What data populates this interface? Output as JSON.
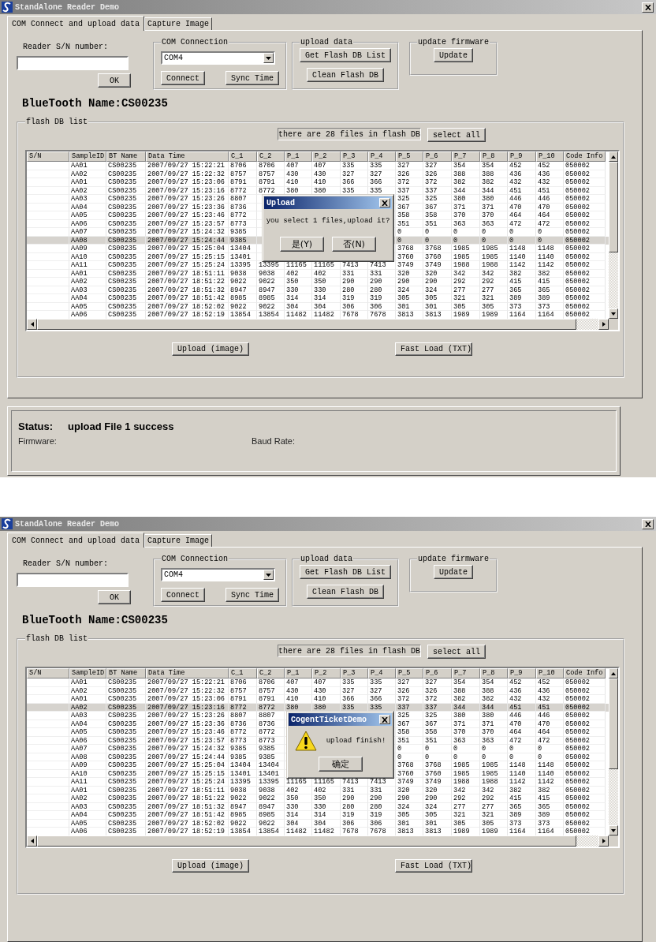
{
  "windows": [
    {
      "title": "StandAlone Reader Demo",
      "tabs": [
        {
          "label": "COM Connect and upload data",
          "selected": true
        },
        {
          "label": "Capture Image",
          "selected": false
        }
      ],
      "reader": {
        "label": "Reader S/N number:",
        "button": "OK"
      },
      "com": {
        "legend": "COM Connection",
        "port": "COM4",
        "buttons": [
          "Connect",
          "Sync Time"
        ]
      },
      "upload": {
        "legend": "upload data",
        "buttons": [
          "Get Flash DB List",
          "Clean Flash DB"
        ]
      },
      "firmware": {
        "legend": "update firmware",
        "button": "Update"
      },
      "bluetooth": "BlueTooth Name:CS00235",
      "flash": {
        "legend": "flash DB list",
        "info": "there are 28 files in flash DB",
        "select_all": "select all",
        "columns": [
          "S/N",
          "SampleID",
          "BT Name",
          "Data Time",
          "C_1",
          "C_2",
          "P_1",
          "P_2",
          "P_3",
          "P_4",
          "P_5",
          "P_6",
          "P_7",
          "P_8",
          "P_9",
          "P_10",
          "Code Info"
        ],
        "rows": [
          {
            "selected": false,
            "cells": [
              "",
              "AA01",
              "CS00235",
              "2007/09/27 15:22:21",
              "8706",
              "8706",
              "407",
              "407",
              "335",
              "335",
              "327",
              "327",
              "354",
              "354",
              "452",
              "452",
              "050002"
            ]
          },
          {
            "selected": false,
            "cells": [
              "",
              "AA02",
              "CS00235",
              "2007/09/27 15:22:32",
              "8757",
              "8757",
              "430",
              "430",
              "327",
              "327",
              "326",
              "326",
              "388",
              "388",
              "436",
              "436",
              "050002"
            ]
          },
          {
            "selected": false,
            "cells": [
              "",
              "AA01",
              "CS00235",
              "2007/09/27 15:23:06",
              "8791",
              "8791",
              "410",
              "410",
              "366",
              "366",
              "372",
              "372",
              "382",
              "382",
              "432",
              "432",
              "050002"
            ]
          },
          {
            "selected": false,
            "cells": [
              "",
              "AA02",
              "CS00235",
              "2007/09/27 15:23:16",
              "8772",
              "8772",
              "380",
              "380",
              "335",
              "335",
              "337",
              "337",
              "344",
              "344",
              "451",
              "451",
              "050002"
            ]
          },
          {
            "selected": false,
            "cells": [
              "",
              "AA03",
              "CS00235",
              "2007/09/27 15:23:26",
              "8807",
              null,
              null,
              null,
              null,
              null,
              "325",
              "325",
              "380",
              "380",
              "446",
              "446",
              "050002"
            ]
          },
          {
            "selected": false,
            "cells": [
              "",
              "AA04",
              "CS00235",
              "2007/09/27 15:23:36",
              "8736",
              null,
              null,
              null,
              null,
              null,
              "367",
              "367",
              "371",
              "371",
              "470",
              "470",
              "050002"
            ]
          },
          {
            "selected": false,
            "cells": [
              "",
              "AA05",
              "CS00235",
              "2007/09/27 15:23:46",
              "8772",
              null,
              null,
              null,
              null,
              null,
              "358",
              "358",
              "370",
              "370",
              "464",
              "464",
              "050002"
            ]
          },
          {
            "selected": false,
            "cells": [
              "",
              "AA06",
              "CS00235",
              "2007/09/27 15:23:57",
              "8773",
              null,
              null,
              null,
              null,
              null,
              "351",
              "351",
              "363",
              "363",
              "472",
              "472",
              "050002"
            ]
          },
          {
            "selected": false,
            "cells": [
              "",
              "AA07",
              "CS00235",
              "2007/09/27 15:24:32",
              "9385",
              null,
              null,
              null,
              null,
              null,
              "0",
              "0",
              "0",
              "0",
              "0",
              "0",
              "050002"
            ]
          },
          {
            "selected": true,
            "cells": [
              "",
              "AA08",
              "CS00235",
              "2007/09/27 15:24:44",
              "9385",
              null,
              null,
              null,
              null,
              null,
              "0",
              "0",
              "0",
              "0",
              "0",
              "0",
              "050002"
            ]
          },
          {
            "selected": false,
            "cells": [
              "",
              "AA09",
              "CS00235",
              "2007/09/27 15:25:04",
              "13404",
              null,
              null,
              null,
              null,
              null,
              "3768",
              "3768",
              "1985",
              "1985",
              "1148",
              "1148",
              "050002"
            ]
          },
          {
            "selected": false,
            "cells": [
              "",
              "AA10",
              "CS00235",
              "2007/09/27 15:25:15",
              "13401",
              null,
              null,
              null,
              null,
              null,
              "3760",
              "3760",
              "1985",
              "1985",
              "1140",
              "1140",
              "050002"
            ]
          },
          {
            "selected": false,
            "cells": [
              "",
              "AA11",
              "CS00235",
              "2007/09/27 15:25:24",
              "13395",
              "13395",
              "11165",
              "11165",
              "7413",
              "7413",
              "3749",
              "3749",
              "1988",
              "1988",
              "1142",
              "1142",
              "050002"
            ]
          },
          {
            "selected": false,
            "cells": [
              "",
              "AA01",
              "CS00235",
              "2007/09/27 18:51:11",
              "9038",
              "9038",
              "402",
              "402",
              "331",
              "331",
              "320",
              "320",
              "342",
              "342",
              "382",
              "382",
              "050002"
            ]
          },
          {
            "selected": false,
            "cells": [
              "",
              "AA02",
              "CS00235",
              "2007/09/27 18:51:22",
              "9022",
              "9022",
              "350",
              "350",
              "290",
              "290",
              "290",
              "290",
              "292",
              "292",
              "415",
              "415",
              "050002"
            ]
          },
          {
            "selected": false,
            "cells": [
              "",
              "AA03",
              "CS00235",
              "2007/09/27 18:51:32",
              "8947",
              "8947",
              "330",
              "330",
              "280",
              "280",
              "324",
              "324",
              "277",
              "277",
              "365",
              "365",
              "050002"
            ]
          },
          {
            "selected": false,
            "cells": [
              "",
              "AA04",
              "CS00235",
              "2007/09/27 18:51:42",
              "8985",
              "8985",
              "314",
              "314",
              "319",
              "319",
              "305",
              "305",
              "321",
              "321",
              "389",
              "389",
              "050002"
            ]
          },
          {
            "selected": false,
            "cells": [
              "",
              "AA05",
              "CS00235",
              "2007/09/27 18:52:02",
              "9022",
              "9022",
              "304",
              "304",
              "306",
              "306",
              "301",
              "301",
              "305",
              "305",
              "373",
              "373",
              "050002"
            ]
          },
          {
            "selected": false,
            "cells": [
              "",
              "AA06",
              "CS00235",
              "2007/09/27 18:52:19",
              "13854",
              "13854",
              "11482",
              "11482",
              "7678",
              "7678",
              "3813",
              "3813",
              "1989",
              "1989",
              "1164",
              "1164",
              "050002"
            ]
          }
        ],
        "buttons": [
          "Upload (image)",
          "Fast Load (TXT)"
        ]
      },
      "dialog": {
        "kind": "question",
        "title": "Upload",
        "message": "you select 1 files,upload it?",
        "buttons": [
          "是(Y)",
          "否(N)"
        ]
      },
      "status": {
        "label": "Status:",
        "value": "upload File 1 success",
        "fields": [
          "Firmware:",
          "Baud Rate:"
        ]
      }
    },
    {
      "title": "StandAlone Reader Demo",
      "tabs": [
        {
          "label": "COM Connect and upload data",
          "selected": true
        },
        {
          "label": "Capture Image",
          "selected": false
        }
      ],
      "reader": {
        "label": "Reader S/N number:",
        "button": "OK"
      },
      "com": {
        "legend": "COM Connection",
        "port": "COM4",
        "buttons": [
          "Connect",
          "Sync Time"
        ]
      },
      "upload": {
        "legend": "upload data",
        "buttons": [
          "Get Flash DB List",
          "Clean Flash DB"
        ]
      },
      "firmware": {
        "legend": "update firmware",
        "button": "Update"
      },
      "bluetooth": "BlueTooth Name:CS00235",
      "flash": {
        "legend": "flash DB list",
        "info": "there are 28 files in flash DB",
        "select_all": "select all",
        "columns": [
          "S/N",
          "SampleID",
          "BT Name",
          "Data Time",
          "C_1",
          "C_2",
          "P_1",
          "P_2",
          "P_3",
          "P_4",
          "P_5",
          "P_6",
          "P_7",
          "P_8",
          "P_9",
          "P_10",
          "Code Info"
        ],
        "rows": [
          {
            "selected": false,
            "cells": [
              "",
              "AA01",
              "CS00235",
              "2007/09/27 15:22:21",
              "8706",
              "8706",
              "407",
              "407",
              "335",
              "335",
              "327",
              "327",
              "354",
              "354",
              "452",
              "452",
              "050002"
            ]
          },
          {
            "selected": false,
            "cells": [
              "",
              "AA02",
              "CS00235",
              "2007/09/27 15:22:32",
              "8757",
              "8757",
              "430",
              "430",
              "327",
              "327",
              "326",
              "326",
              "388",
              "388",
              "436",
              "436",
              "050002"
            ]
          },
          {
            "selected": false,
            "cells": [
              "",
              "AA01",
              "CS00235",
              "2007/09/27 15:23:06",
              "8791",
              "8791",
              "410",
              "410",
              "366",
              "366",
              "372",
              "372",
              "382",
              "382",
              "432",
              "432",
              "050002"
            ]
          },
          {
            "selected": true,
            "cells": [
              "",
              "AA02",
              "CS00235",
              "2007/09/27 15:23:16",
              "8772",
              "8772",
              "380",
              "380",
              "335",
              "335",
              "337",
              "337",
              "344",
              "344",
              "451",
              "451",
              "050002"
            ]
          },
          {
            "selected": false,
            "cells": [
              "",
              "AA03",
              "CS00235",
              "2007/09/27 15:23:26",
              "8807",
              "8807",
              null,
              null,
              null,
              null,
              "325",
              "325",
              "380",
              "380",
              "446",
              "446",
              "050002"
            ]
          },
          {
            "selected": false,
            "cells": [
              "",
              "AA04",
              "CS00235",
              "2007/09/27 15:23:36",
              "8736",
              "8736",
              null,
              null,
              null,
              null,
              "367",
              "367",
              "371",
              "371",
              "470",
              "470",
              "050002"
            ]
          },
          {
            "selected": false,
            "cells": [
              "",
              "AA05",
              "CS00235",
              "2007/09/27 15:23:46",
              "8772",
              "8772",
              null,
              null,
              null,
              null,
              "358",
              "358",
              "370",
              "370",
              "464",
              "464",
              "050002"
            ]
          },
          {
            "selected": false,
            "cells": [
              "",
              "AA06",
              "CS00235",
              "2007/09/27 15:23:57",
              "8773",
              "8773",
              null,
              null,
              null,
              null,
              "351",
              "351",
              "363",
              "363",
              "472",
              "472",
              "050002"
            ]
          },
          {
            "selected": false,
            "cells": [
              "",
              "AA07",
              "CS00235",
              "2007/09/27 15:24:32",
              "9385",
              "9385",
              null,
              null,
              null,
              null,
              "0",
              "0",
              "0",
              "0",
              "0",
              "0",
              "050002"
            ]
          },
          {
            "selected": false,
            "cells": [
              "",
              "AA08",
              "CS00235",
              "2007/09/27 15:24:44",
              "9385",
              "9385",
              null,
              null,
              null,
              null,
              "0",
              "0",
              "0",
              "0",
              "0",
              "0",
              "050002"
            ]
          },
          {
            "selected": false,
            "cells": [
              "",
              "AA09",
              "CS00235",
              "2007/09/27 15:25:04",
              "13404",
              "13404",
              null,
              null,
              null,
              null,
              "3768",
              "3768",
              "1985",
              "1985",
              "1148",
              "1148",
              "050002"
            ]
          },
          {
            "selected": false,
            "cells": [
              "",
              "AA10",
              "CS00235",
              "2007/09/27 15:25:15",
              "13401",
              "13401",
              null,
              null,
              null,
              null,
              "3760",
              "3760",
              "1985",
              "1985",
              "1140",
              "1140",
              "050002"
            ]
          },
          {
            "selected": false,
            "cells": [
              "",
              "AA11",
              "CS00235",
              "2007/09/27 15:25:24",
              "13395",
              "13395",
              "11165",
              "11165",
              "7413",
              "7413",
              "3749",
              "3749",
              "1988",
              "1988",
              "1142",
              "1142",
              "050002"
            ]
          },
          {
            "selected": false,
            "cells": [
              "",
              "AA01",
              "CS00235",
              "2007/09/27 18:51:11",
              "9038",
              "9038",
              "402",
              "402",
              "331",
              "331",
              "320",
              "320",
              "342",
              "342",
              "382",
              "382",
              "050002"
            ]
          },
          {
            "selected": false,
            "cells": [
              "",
              "AA02",
              "CS00235",
              "2007/09/27 18:51:22",
              "9022",
              "9022",
              "350",
              "350",
              "290",
              "290",
              "290",
              "290",
              "292",
              "292",
              "415",
              "415",
              "050002"
            ]
          },
          {
            "selected": false,
            "cells": [
              "",
              "AA03",
              "CS00235",
              "2007/09/27 18:51:32",
              "8947",
              "8947",
              "330",
              "330",
              "280",
              "280",
              "324",
              "324",
              "277",
              "277",
              "365",
              "365",
              "050002"
            ]
          },
          {
            "selected": false,
            "cells": [
              "",
              "AA04",
              "CS00235",
              "2007/09/27 18:51:42",
              "8985",
              "8985",
              "314",
              "314",
              "319",
              "319",
              "305",
              "305",
              "321",
              "321",
              "389",
              "389",
              "050002"
            ]
          },
          {
            "selected": false,
            "cells": [
              "",
              "AA05",
              "CS00235",
              "2007/09/27 18:52:02",
              "9022",
              "9022",
              "304",
              "304",
              "306",
              "306",
              "301",
              "301",
              "305",
              "305",
              "373",
              "373",
              "050002"
            ]
          },
          {
            "selected": false,
            "cells": [
              "",
              "AA06",
              "CS00235",
              "2007/09/27 18:52:19",
              "13854",
              "13854",
              "11482",
              "11482",
              "7678",
              "7678",
              "3813",
              "3813",
              "1989",
              "1989",
              "1164",
              "1164",
              "050002"
            ]
          }
        ],
        "buttons": [
          "Upload (image)",
          "Fast Load (TXT)"
        ]
      },
      "dialog": {
        "kind": "warning",
        "title": "CogentTicketDemo",
        "message": "upload finish!",
        "buttons": [
          "确定"
        ]
      }
    }
  ]
}
